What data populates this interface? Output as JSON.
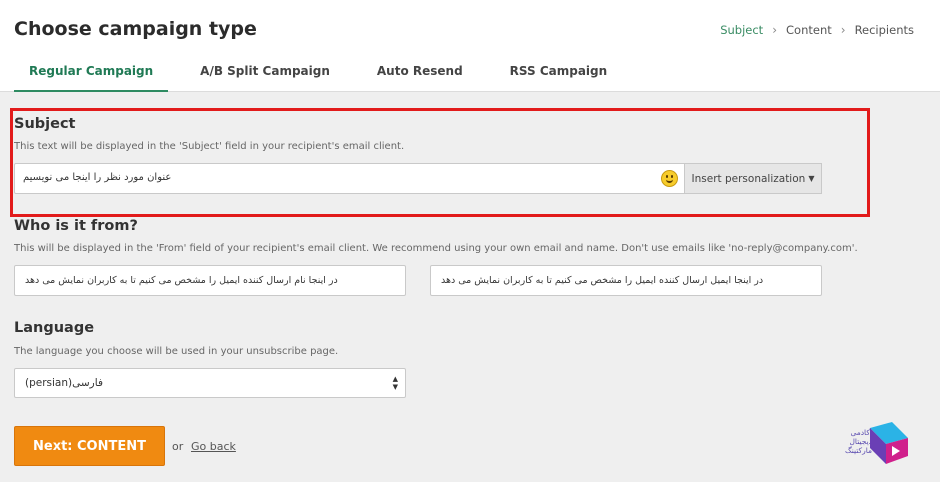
{
  "header": {
    "title": "Choose campaign type",
    "breadcrumb": [
      "Subject",
      "Content",
      "Recipients"
    ],
    "tabs": [
      {
        "label": "Regular Campaign",
        "active": true
      },
      {
        "label": "A/B Split Campaign"
      },
      {
        "label": "Auto Resend"
      },
      {
        "label": "RSS Campaign"
      }
    ]
  },
  "subject": {
    "heading": "Subject",
    "help": "This text will be displayed in the 'Subject' field in your recipient's email client.",
    "value": "عنوان مورد نظر را اینجا می نویسیم",
    "personalize_label": "Insert personalization",
    "emoji_icon": "smiley-icon"
  },
  "from": {
    "heading": "Who is it from?",
    "help": "This will be displayed in the 'From' field of your recipient's email client. We recommend using your own email and name. Don't use emails like 'no-reply@company.com'.",
    "name_value": "در اینجا نام ارسال کننده ایمیل را مشخص می کنیم تا به کاربران نمایش می دهد",
    "email_value": "در اینجا ایمیل ارسال کننده ایمیل را مشخص می کنیم تا به کاربران نمایش می دهد"
  },
  "language": {
    "heading": "Language",
    "help": "The language you choose will be used in your unsubscribe page.",
    "selected": "(persian)فارسی"
  },
  "actions": {
    "next_label": "Next: CONTENT",
    "or_label": "or",
    "back_label": "Go back"
  },
  "logo": {
    "text": "آکادمی دیجیتال مارکتینگ"
  },
  "colors": {
    "accent_green": "#2e8b62",
    "highlight_red": "#e21b1b",
    "button_orange": "#f08a11",
    "logo_purple": "#5a4bb0",
    "logo_magenta": "#d0208c"
  }
}
